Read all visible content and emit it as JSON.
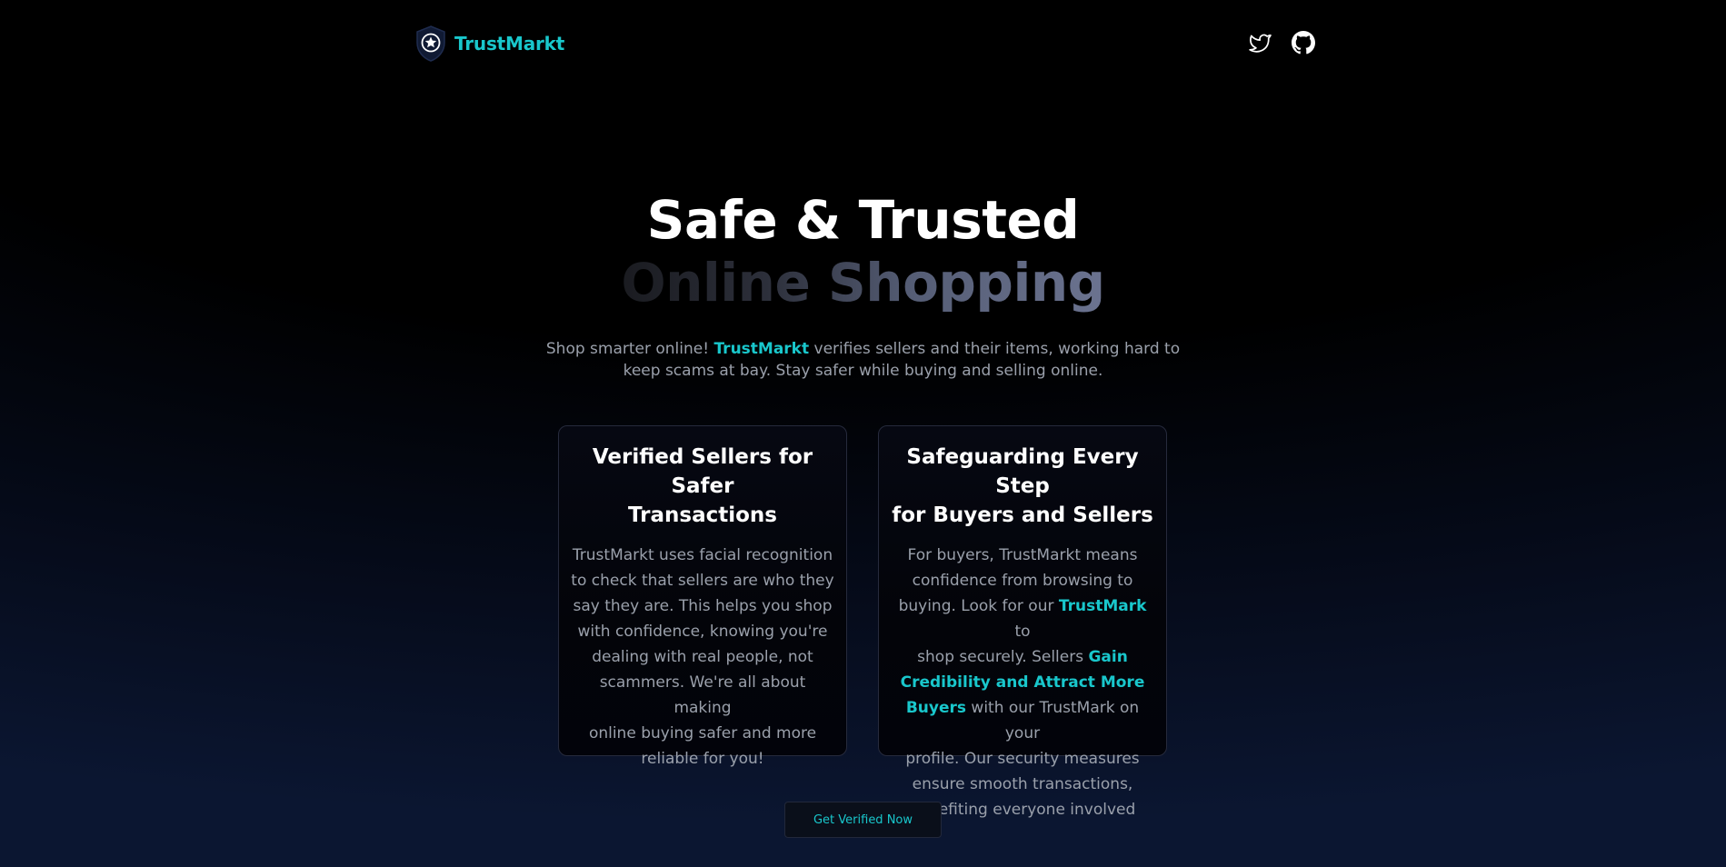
{
  "brand": {
    "name": "TrustMarkt",
    "logo_icon": "shield-star-icon",
    "accent_color": "#19c7cc"
  },
  "nav": {
    "social": [
      {
        "icon": "twitter-icon"
      },
      {
        "icon": "github-icon"
      }
    ]
  },
  "hero": {
    "title_line1": "Safe & Trusted",
    "title_line2": "Online Shopping",
    "subtitle_before": "Shop smarter online! ",
    "subtitle_highlight": "TrustMarkt",
    "subtitle_line1_after": " verifies sellers and their items, working hard to",
    "subtitle_line2": "keep scams at bay. Stay safer while buying and selling online."
  },
  "cards": [
    {
      "title_line1": "Verified Sellers for Safer",
      "title_line2": "Transactions",
      "body_lines": [
        "TrustMarkt uses facial recognition",
        "to check that sellers are who they",
        "say they are. This helps you shop",
        "with confidence, knowing you're",
        "dealing with real people, not",
        "scammers. We're all about making",
        "online buying safer and more",
        "reliable for you!"
      ]
    },
    {
      "title_line1": "Safeguarding Every Step",
      "title_line2": "for Buyers and Sellers",
      "line1": "For buyers, TrustMarkt means",
      "line2": "confidence from browsing to",
      "line3_before": "buying. Look for our ",
      "line3_highlight": "TrustMark",
      "line3_after": " to",
      "line4_before": "shop securely. Sellers ",
      "line4_highlight": "Gain",
      "line5_highlight": "Credibility and Attract More",
      "line6_highlight": "Buyers",
      "line6_after": " with our TrustMark on your",
      "line7": "profile. Our security measures",
      "line8": "ensure smooth transactions,",
      "line9": "benefiting everyone involved"
    }
  ],
  "cta": {
    "label": "Get Verified Now"
  }
}
